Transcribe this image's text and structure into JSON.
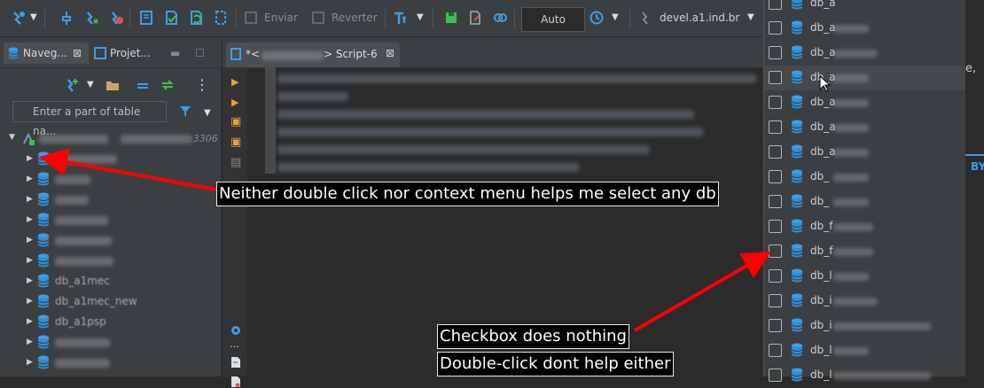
{
  "toolbar": {
    "enviar_label": "Enviar",
    "reverter_label": "Reverter",
    "auto_label": "Auto",
    "connection_label": "devel.a1.ind.br"
  },
  "left_panel": {
    "tabs": [
      {
        "label": "Naveg..."
      },
      {
        "label": "Projet..."
      }
    ],
    "filter_placeholder": "Enter a part of table na...",
    "root_suffix": ":3306",
    "tree_item_labels": [
      "db_a1mec",
      "db_a1mec_new",
      "db_a1psp"
    ]
  },
  "editor": {
    "tab_prefix": "*<",
    "tab_suffix": "> Script-6",
    "side_label": "BY"
  },
  "db_list": {
    "prefix_short": "db_",
    "prefix_short_i": "db_i",
    "prefix_short_l": "db_l",
    "prefix_short_f": "db_f",
    "prefix_short_a": "db_a"
  },
  "annotations": {
    "callout_1": "Neither double click nor context menu helps me select any db",
    "callout_2": "Checkbox does nothing",
    "callout_3": "Double-click dont help either"
  },
  "colors": {
    "accent": "#2f8fd8",
    "arrow": "#ff0000",
    "toolbar_bg": "#3c3f41",
    "editor_bg": "#2b2b2b"
  }
}
